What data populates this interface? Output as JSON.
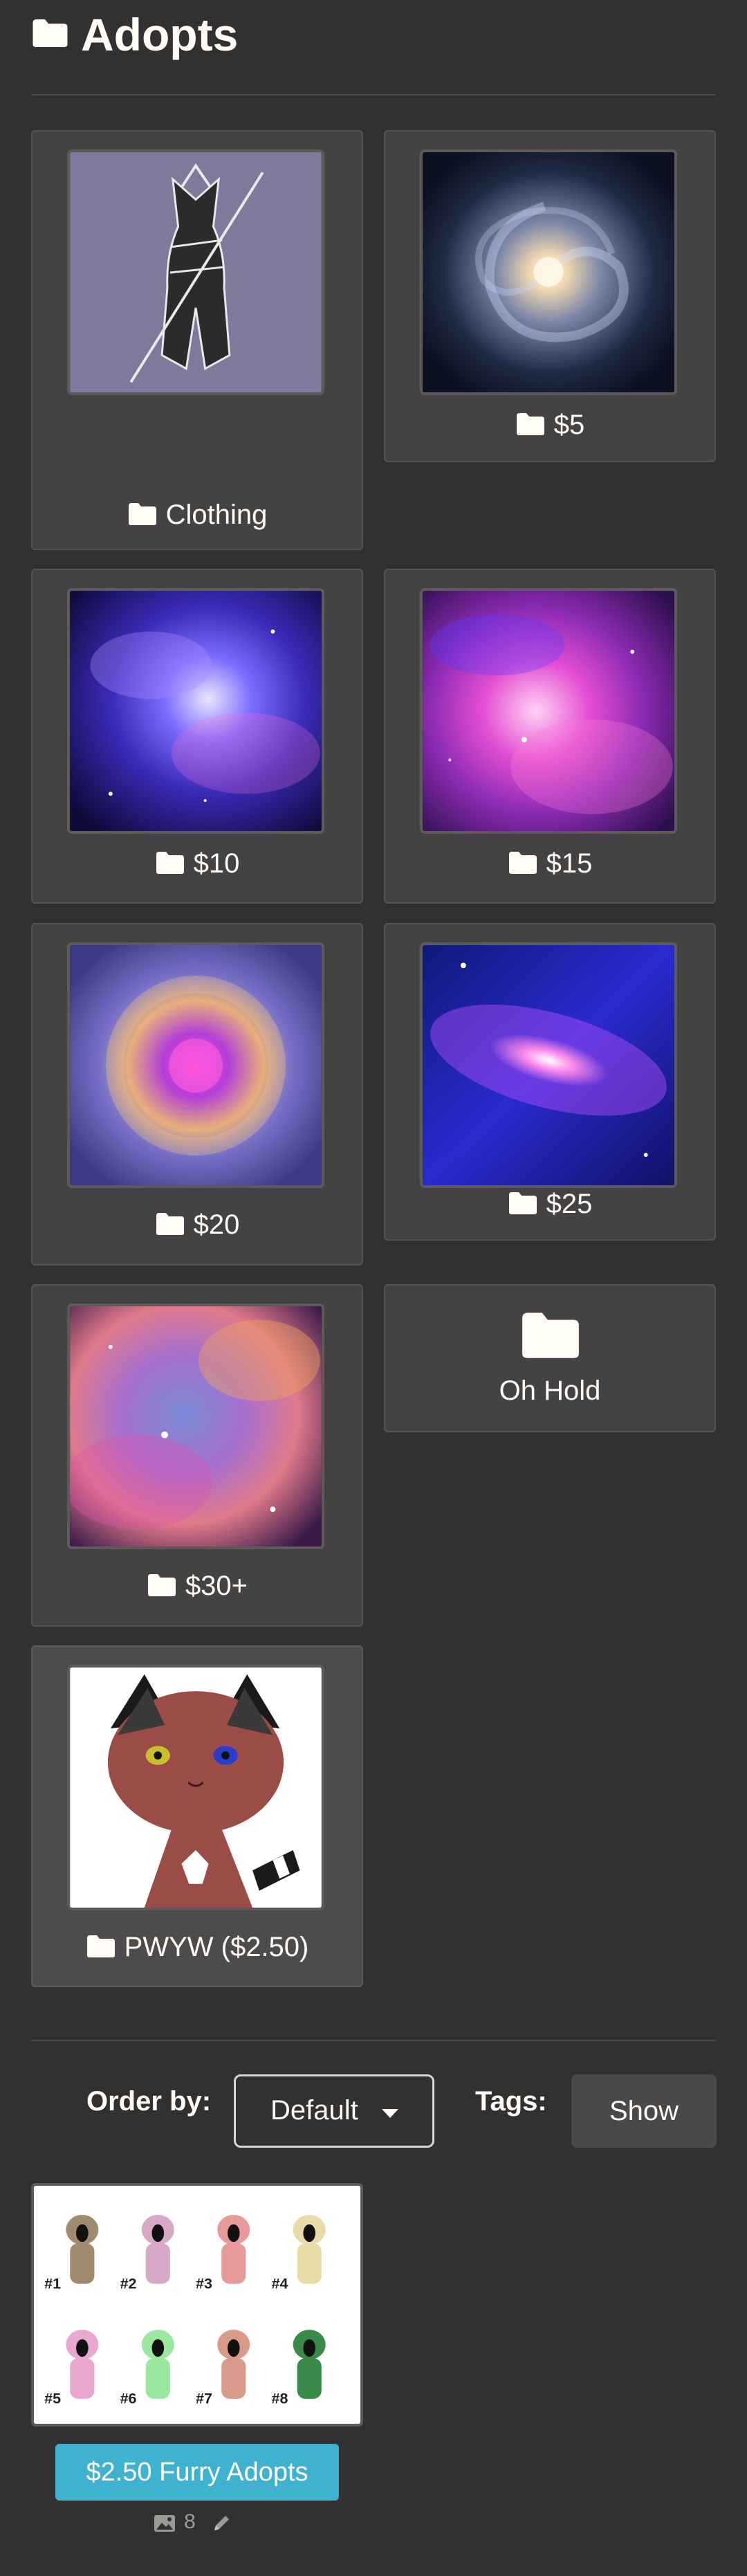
{
  "header": {
    "title": "Adopts",
    "icon": "folder-icon"
  },
  "folders": [
    {
      "label": "Clothing",
      "art": "clothing"
    },
    {
      "label": "$5",
      "art": "spiral"
    },
    {
      "label": "$10",
      "art": "blue-nebula"
    },
    {
      "label": "$15",
      "art": "pink-nebula"
    },
    {
      "label": "$20",
      "art": "helix"
    },
    {
      "label": "$25",
      "art": "galaxy"
    },
    {
      "label": "$30+",
      "art": "colorful-nebula"
    },
    {
      "label": "Oh Hold",
      "art": "empty-folder"
    },
    {
      "label": "PWYW ($2.50)",
      "art": "cat"
    }
  ],
  "controls": {
    "order_label": "Order by:",
    "order_value": "Default",
    "tags_label": "Tags:",
    "show_label": "Show"
  },
  "submission": {
    "title": "$2.50 Furry Adopts",
    "image_count": "8",
    "thumb_numbers": [
      "#1",
      "#2",
      "#3",
      "#4",
      "#5",
      "#6",
      "#7",
      "#8"
    ]
  },
  "colors": {
    "background": "#323031",
    "card": "#454243",
    "accent": "#3fb2cf",
    "text": "#fffdf5"
  }
}
